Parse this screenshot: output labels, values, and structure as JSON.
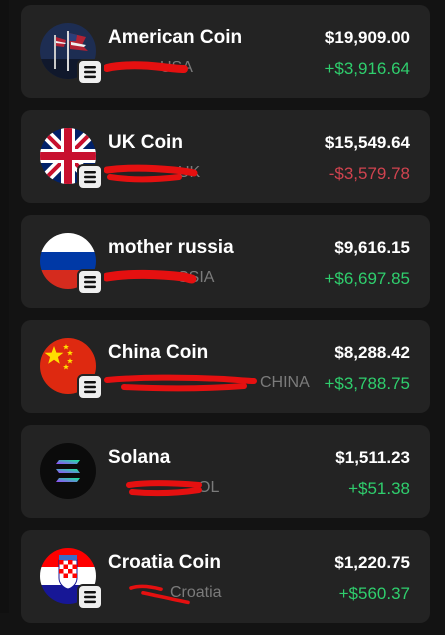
{
  "colors": {
    "positive": "#2fce6d",
    "negative": "#d0434f",
    "redaction": "#e51010"
  },
  "coins": [
    {
      "name": "American Coin",
      "sub": "USA",
      "value": "$19,909.00",
      "change": "+$3,916.64",
      "direction": "up",
      "icon": "usa-flag-icon"
    },
    {
      "name": "UK Coin",
      "sub": "UK",
      "value": "$15,549.64",
      "change": "-$3,579.78",
      "direction": "down",
      "icon": "uk-flag-icon"
    },
    {
      "name": "mother russia",
      "sub": "SSIA",
      "value": "$9,616.15",
      "change": "+$6,697.85",
      "direction": "up",
      "icon": "russia-flag-icon"
    },
    {
      "name": "China Coin",
      "sub": "CHINA",
      "value": "$8,288.42",
      "change": "+$3,788.75",
      "direction": "up",
      "icon": "china-flag-icon"
    },
    {
      "name": "Solana",
      "sub": "OL",
      "value": "$1,511.23",
      "change": "+$51.38",
      "direction": "up",
      "icon": "solana-logo-icon"
    },
    {
      "name": "Croatia Coin",
      "sub": "Croatia",
      "value": "$1,220.75",
      "change": "+$560.37",
      "direction": "up",
      "icon": "croatia-flag-icon"
    }
  ]
}
